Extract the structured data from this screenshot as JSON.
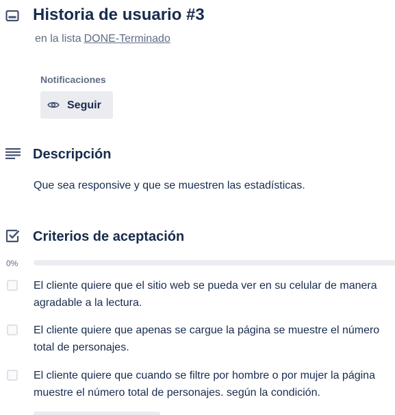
{
  "card": {
    "title": "Historia de usuario #3",
    "list_prefix": "en la lista",
    "list_name": "DONE-Terminado"
  },
  "notifications": {
    "label": "Notificaciones",
    "follow_button": "Seguir"
  },
  "description": {
    "heading": "Descripción",
    "text": "Que sea responsive y que se muestren las estadísticas."
  },
  "checklist": {
    "heading": "Criterios de aceptación",
    "progress_text": "0%",
    "progress_value": 0,
    "items": [
      {
        "text": "El cliente quiere que el sitio web se pueda ver en su celular de manera agradable a la lectura.",
        "checked": false
      },
      {
        "text": "El cliente quiere que apenas se cargue la página se muestre el número total de personajes.",
        "checked": false
      },
      {
        "text": "El cliente quiere que cuando se filtre por hombre o por mujer la página muestre el número total de personajes. según la condición.",
        "checked": false
      }
    ]
  },
  "colors": {
    "text_primary": "#172b4d",
    "text_secondary": "#5e6c84",
    "button_bg": "#ebecf0",
    "progress_fill": "#5ba4cf"
  },
  "icons": {
    "card": "card-icon",
    "follow": "eye-icon",
    "description": "description-icon",
    "checklist": "checklist-icon"
  }
}
